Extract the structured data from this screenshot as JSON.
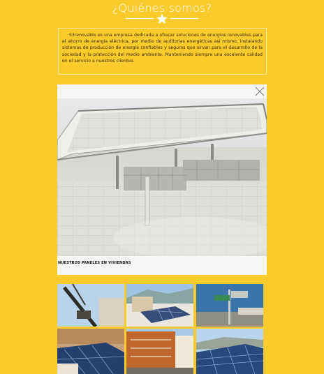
{
  "section": {
    "title": "¿Quiénes somos?",
    "about_text": "S3renovable es una empresa dedicada a ofrecer soluciones de energías renovables para el ahorro de energía eléctrica, por medio de auditorias energéticas así mismo, instalando sistemas de producción de energía confiables y seguros que sirvan para el desarrollo de la sociedad y la protección del medio ambiente. Manteniendo siempre una excelente calidad en el servicio a nuestros clientes."
  },
  "lightbox": {
    "caption": "Nuestros Paneles En Viviendas",
    "close_icon": "close-icon"
  },
  "gallery": {
    "thumbnails": [
      {
        "icon": "image-thumbnail"
      },
      {
        "icon": "image-thumbnail"
      },
      {
        "icon": "image-thumbnail"
      },
      {
        "icon": "image-thumbnail"
      },
      {
        "icon": "image-thumbnail"
      },
      {
        "icon": "image-thumbnail"
      }
    ]
  },
  "colors": {
    "background": "#fbca2c",
    "text_light": "#ffffff",
    "text_dark": "#3a2f10"
  }
}
